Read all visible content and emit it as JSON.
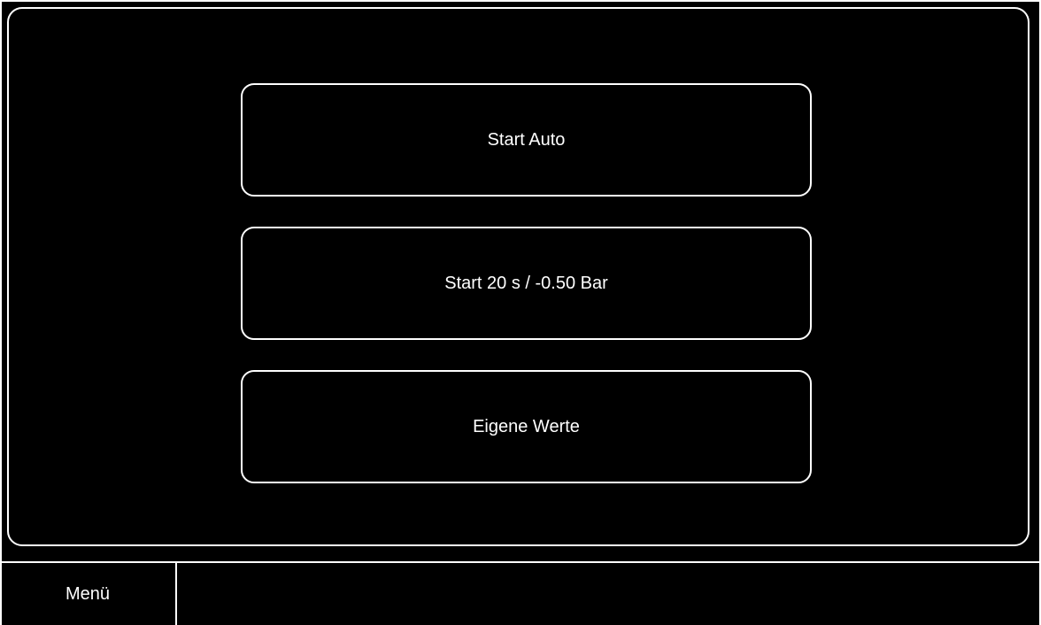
{
  "main": {
    "buttons": [
      {
        "label": "Start Auto"
      },
      {
        "label": "Start 20 s / -0.50 Bar"
      },
      {
        "label": "Eigene Werte"
      }
    ]
  },
  "footer": {
    "menu_label": "Menü",
    "status_text": ""
  },
  "colors": {
    "background": "#000000",
    "foreground": "#ffffff"
  }
}
